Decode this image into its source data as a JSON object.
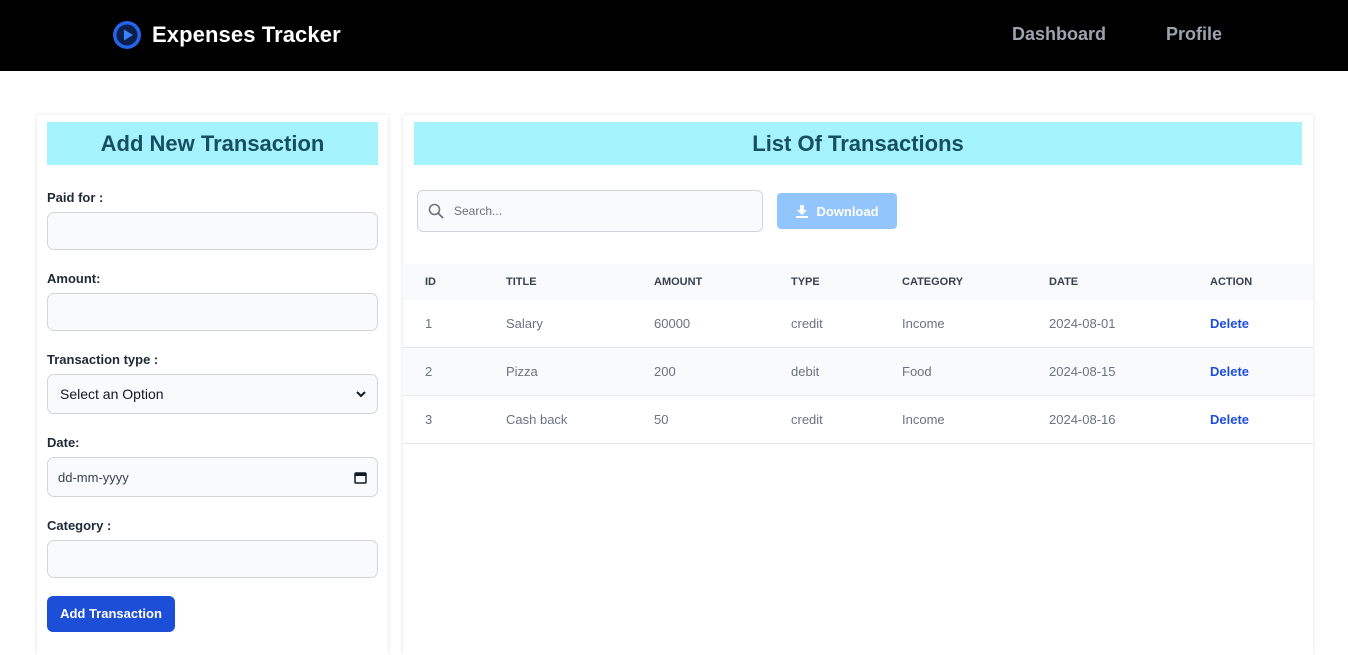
{
  "navbar": {
    "title": "Expenses Tracker",
    "links": [
      "Dashboard",
      "Profile"
    ],
    "logo_icon": "play-circle-logo-icon"
  },
  "form": {
    "heading": "Add New Transaction",
    "paid_for_label": "Paid for :",
    "paid_for_value": "",
    "amount_label": "Amount:",
    "amount_value": "",
    "type_label": "Transaction type :",
    "type_selected": "Select an Option",
    "date_label": "Date:",
    "date_placeholder": "dd-mm-yyyy",
    "category_label": "Category :",
    "category_value": "",
    "submit_label": "Add Transaction"
  },
  "list": {
    "heading": "List Of Transactions",
    "search_placeholder": "Search...",
    "download_label": "Download",
    "columns": [
      "ID",
      "TITLE",
      "AMOUNT",
      "TYPE",
      "CATEGORY",
      "DATE",
      "ACTION"
    ],
    "rows": [
      {
        "id": "1",
        "title": "Salary",
        "amount": "60000",
        "type": "credit",
        "category": "Income",
        "date": "2024-08-01",
        "action": "Delete"
      },
      {
        "id": "2",
        "title": "Pizza",
        "amount": "200",
        "type": "debit",
        "category": "Food",
        "date": "2024-08-15",
        "action": "Delete"
      },
      {
        "id": "3",
        "title": "Cash back",
        "amount": "50",
        "type": "credit",
        "category": "Income",
        "date": "2024-08-16",
        "action": "Delete"
      }
    ]
  },
  "colors": {
    "navbar_bg": "#000000",
    "heading_bg": "#a5f3fc",
    "heading_text": "#164e63",
    "primary_button": "#1d4ed8",
    "download_button": "#93c5fd",
    "delete_link": "#1d4ed8"
  }
}
